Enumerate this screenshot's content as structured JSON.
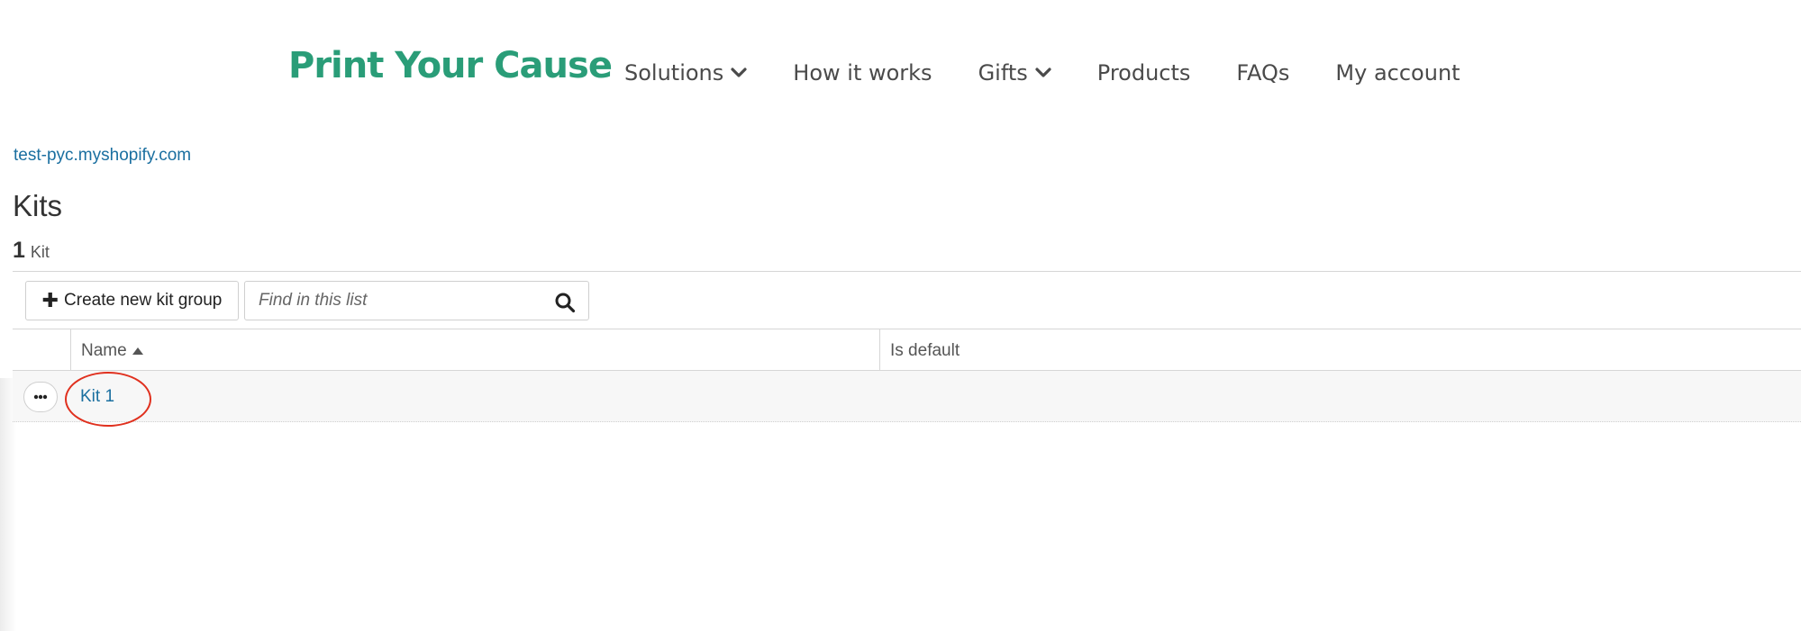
{
  "header": {
    "logo": "Print Your Cause",
    "nav": [
      {
        "label": "Solutions",
        "has_dropdown": true
      },
      {
        "label": "How it works",
        "has_dropdown": false
      },
      {
        "label": "Gifts",
        "has_dropdown": true
      },
      {
        "label": "Products",
        "has_dropdown": false
      },
      {
        "label": "FAQs",
        "has_dropdown": false
      },
      {
        "label": "My account",
        "has_dropdown": false
      }
    ]
  },
  "store": {
    "link": "test-pyc.myshopify.com"
  },
  "page": {
    "title": "Kits",
    "count": "1",
    "count_label": "Kit"
  },
  "toolbar": {
    "create_label": "Create new kit group",
    "search_placeholder": "Find in this list"
  },
  "table": {
    "columns": [
      "Name",
      "Is default"
    ],
    "sort_column": "Name",
    "sort_direction": "asc",
    "rows": [
      {
        "name": "Kit 1",
        "is_default": ""
      }
    ]
  },
  "icons": {
    "create": "plus-icon",
    "search": "search-icon",
    "row_actions": "ellipsis-icon",
    "dropdown": "chevron-down-icon",
    "sort": "sort-up-icon"
  },
  "colors": {
    "brand": "#2a9d78",
    "link": "#1a6fa0",
    "annotation": "#e0301e"
  }
}
